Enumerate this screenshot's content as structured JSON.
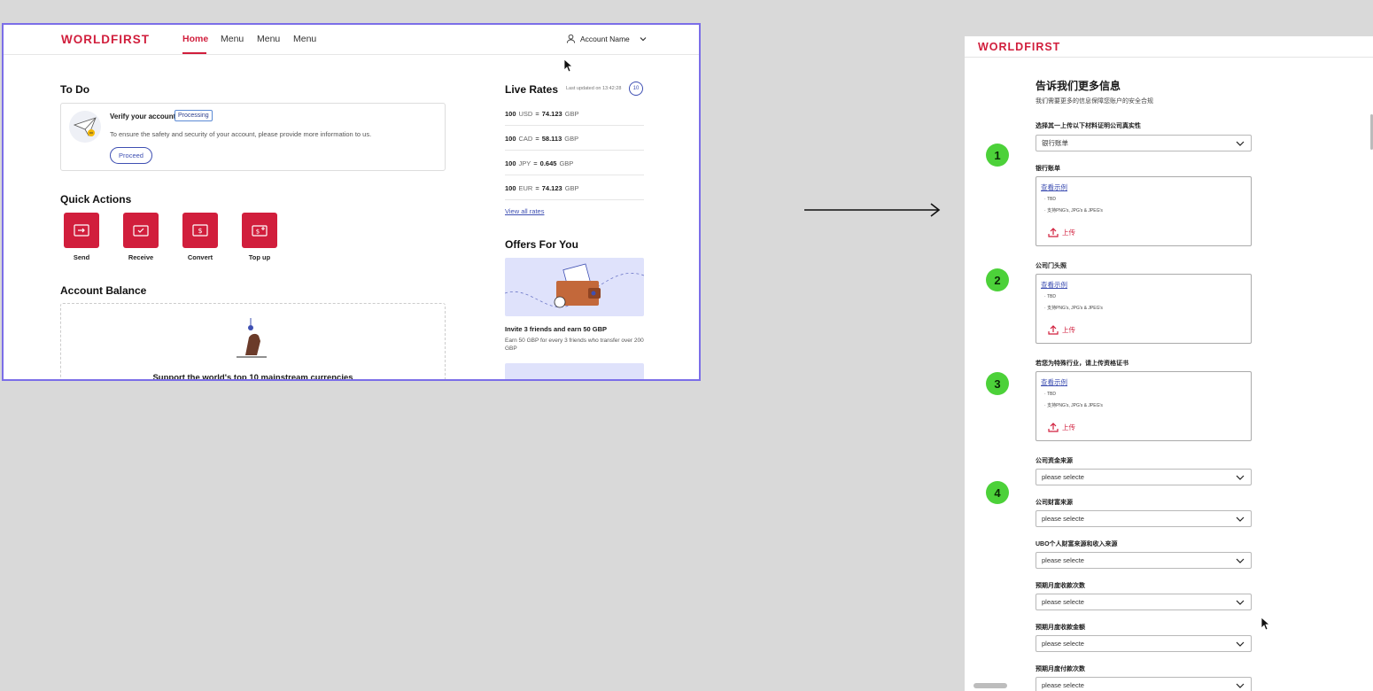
{
  "dashboard": {
    "logo": "WORLDFIRST",
    "nav": [
      "Home",
      "Menu",
      "Menu",
      "Menu"
    ],
    "account_name": "Account Name",
    "todo": {
      "heading": "To Do",
      "title": "Verify your account",
      "badge": "Processing",
      "description": "To ensure the safety and security of your account, please provide more information to us.",
      "button": "Proceed"
    },
    "quick_actions": {
      "heading": "Quick Actions",
      "items": [
        "Send",
        "Receive",
        "Convert",
        "Top up"
      ]
    },
    "balance": {
      "heading": "Account Balance",
      "text": "Support the world's top 10 mainstream currencies"
    },
    "rates": {
      "heading": "Live Rates",
      "updated": "Last updated on 13:42:28",
      "timer": "10",
      "rows": [
        {
          "amount": "100",
          "from": "USD",
          "eq": "=",
          "value": "74.123",
          "to": "GBP"
        },
        {
          "amount": "100",
          "from": "CAD",
          "eq": "=",
          "value": "58.113",
          "to": "GBP"
        },
        {
          "amount": "100",
          "from": "JPY",
          "eq": "=",
          "value": "0.645",
          "to": "GBP"
        },
        {
          "amount": "100",
          "from": "EUR",
          "eq": "=",
          "value": "74.123",
          "to": "GBP"
        }
      ],
      "view_all": "View all rates"
    },
    "offers": {
      "heading": "Offers For You",
      "title": "Invite 3 friends and earn 50 GBP",
      "desc": "Earn 50 GBP for every 3 friends who transfer over 200 GBP"
    }
  },
  "form": {
    "logo": "WORLDFIRST",
    "title": "告诉我们更多信息",
    "subtitle": "我们需要更多的信息保障您账户的安全合规",
    "select_prove_label": "选择其一上传以下材料证明公司真实性",
    "select_prove_value": "银行账单",
    "view_example": "查看示例",
    "req_tbd": "TBD",
    "req_formats": "支持PNG's, JPG's & JPEG's",
    "upload": "上传",
    "uploads": [
      "银行账单",
      "公司门头照",
      "若您为特殊行业，请上传资格证书"
    ],
    "steps": [
      "1",
      "2",
      "3",
      "4"
    ],
    "selects": [
      {
        "label": "公司资金来源",
        "value": "please selecte"
      },
      {
        "label": "公司财富来源",
        "value": "please selecte"
      },
      {
        "label": "UBO个人财富来源和收入来源",
        "value": "please selecte"
      },
      {
        "label": "预期月度收款次数",
        "value": "please selecte"
      },
      {
        "label": "预期月度收款金额",
        "value": "please selecte"
      },
      {
        "label": "预期月度付款次数",
        "value": "please selecte"
      }
    ]
  },
  "colors": {
    "brand": "#d11e3c",
    "accent": "#3e4fb2",
    "step": "#4cd139",
    "frame": "#7b6ee8"
  }
}
